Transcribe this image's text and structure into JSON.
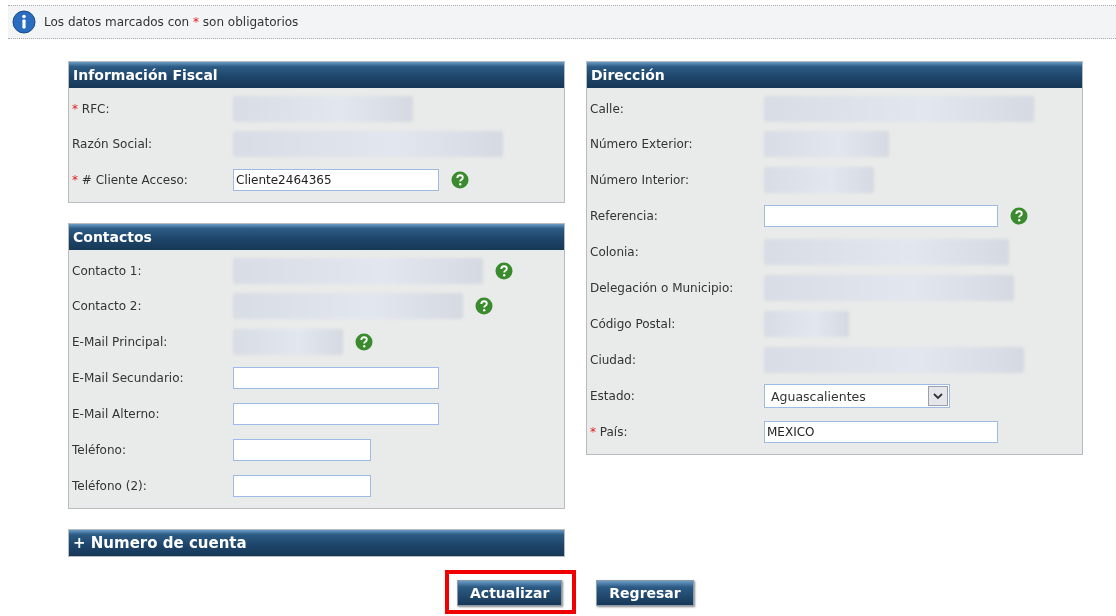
{
  "notice": {
    "before": "Los datos marcados con",
    "mark": "*",
    "after": "son obligatorios"
  },
  "left_panels": [
    {
      "title": "Información Fiscal",
      "rows": [
        {
          "label": "RFC:",
          "required_mark": "*",
          "kind": "blurred",
          "help": false
        },
        {
          "label": "Razón Social:",
          "kind": "blurred",
          "help": false
        },
        {
          "label": "# Cliente Acceso:",
          "required_mark": "*",
          "kind": "input",
          "value": "Cliente2464365",
          "help": true
        }
      ]
    },
    {
      "title": "Contactos",
      "rows": [
        {
          "label": "Contacto 1:",
          "kind": "blurred",
          "help": true
        },
        {
          "label": "Contacto 2:",
          "kind": "blurred",
          "help": true
        },
        {
          "label": "E-Mail Principal:",
          "kind": "blurred",
          "help": true
        },
        {
          "label": "E-Mail Secundario:",
          "kind": "input",
          "help": false
        },
        {
          "label": "E-Mail Alterno:",
          "kind": "input",
          "help": false
        },
        {
          "label": "Teléfono:",
          "kind": "short-input",
          "help": false
        },
        {
          "label": "Teléfono (2):",
          "kind": "short-input",
          "help": false
        }
      ]
    }
  ],
  "collapsed_section": {
    "title": "+ Numero de cuenta"
  },
  "right_panel": {
    "title": "Dirección",
    "rows": [
      {
        "label": "Calle:",
        "kind": "blurred",
        "help": false
      },
      {
        "label": "Número Exterior:",
        "kind": "blurred",
        "help": false
      },
      {
        "label": "Número Interior:",
        "kind": "blurred",
        "help": false
      },
      {
        "label": "Referencia:",
        "kind": "input",
        "help": true
      },
      {
        "label": "Colonia:",
        "kind": "blurred",
        "help": false
      },
      {
        "label": "Delegación o Municipio:",
        "kind": "blurred",
        "help": false
      },
      {
        "label": "Código Postal:",
        "kind": "blurred",
        "help": false
      },
      {
        "label": "Ciudad:",
        "kind": "blurred",
        "help": false
      },
      {
        "label": "Estado:",
        "kind": "select",
        "value": "Aguascalientes",
        "help": false
      },
      {
        "label": "País:",
        "required_mark": "*",
        "kind": "input",
        "value": "MEXICO",
        "help": false
      }
    ]
  },
  "buttons": [
    {
      "label": "Actualizar",
      "highlighted": true
    },
    {
      "label": "Regresar",
      "highlighted": false
    }
  ]
}
